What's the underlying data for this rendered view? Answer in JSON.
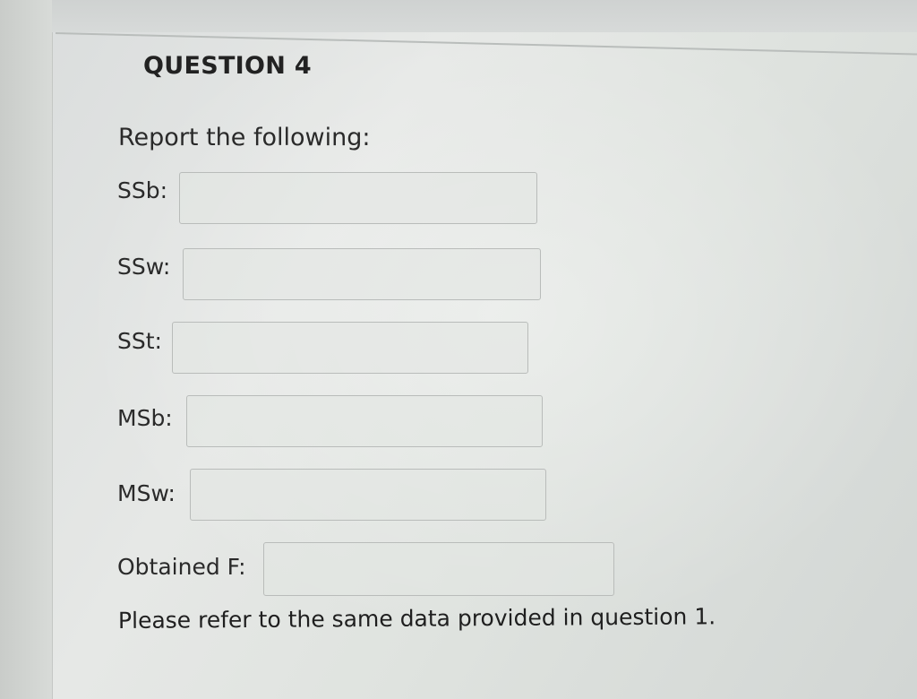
{
  "question": {
    "title": "QUESTION 4",
    "prompt": "Report the following:"
  },
  "fields": [
    {
      "label": "SSb:",
      "value": ""
    },
    {
      "label": "SSw:",
      "value": ""
    },
    {
      "label": "SSt:",
      "value": ""
    },
    {
      "label": "MSb:",
      "value": ""
    },
    {
      "label": "MSw:",
      "value": ""
    },
    {
      "label": "Obtained F:",
      "value": ""
    }
  ],
  "footer_note": "Please refer to the same data provided in question 1."
}
